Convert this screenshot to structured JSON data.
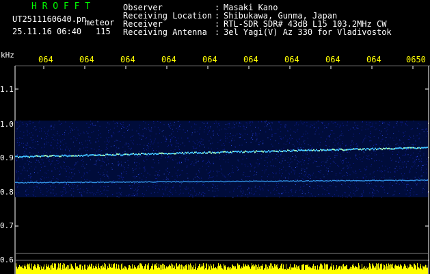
{
  "header": {
    "brand": "H R O F F T",
    "filename": "UT2511160640.pn",
    "mode": "meteor",
    "datetime": "25.11.16 06:40",
    "count": "115",
    "fields": [
      {
        "label": "Observer",
        "value": "Masaki Kano"
      },
      {
        "label": "Receiving Location",
        "value": "Shibukawa, Gunma, Japan"
      },
      {
        "label": "Receiver",
        "value": "RTL-SDR SDR# 43dB L15 103.2MHz CW"
      },
      {
        "label": "Receiving Antenna",
        "value": "3el Yagi(V) Az 330 for Vladivostok"
      }
    ],
    "separator": ":"
  },
  "time_axis": [
    "064",
    "064",
    "064",
    "064",
    "064",
    "064",
    "064",
    "064",
    "064",
    "0650"
  ],
  "freq_axis": {
    "unit": "kHz",
    "labels": [
      "1.1",
      "1.0",
      "0.9",
      "0.8",
      "0.7",
      "0.6"
    ]
  },
  "colors": {
    "background": "#000000",
    "header_text": "#ffffff",
    "brand": "#00ff00",
    "ticks": "#ffff00",
    "noise": "#1020a0",
    "signal": "#40c0ff",
    "bottom_bars": "#ffff00"
  }
}
